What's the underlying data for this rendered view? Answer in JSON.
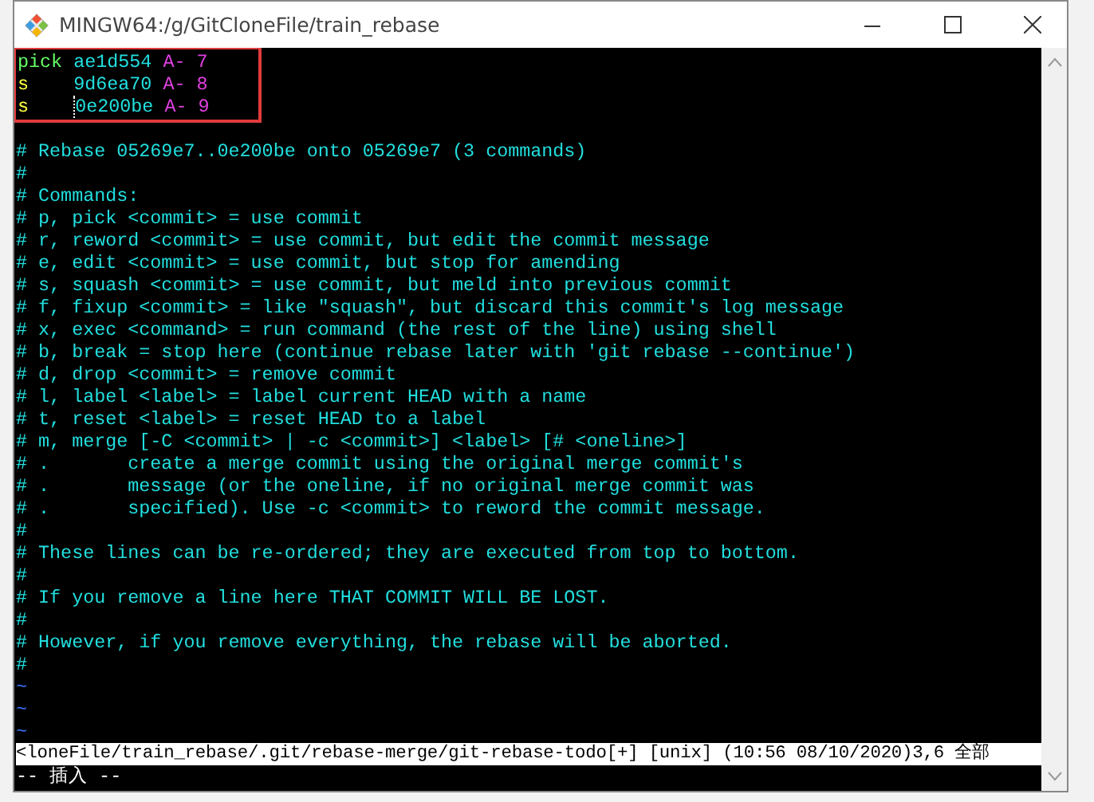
{
  "window": {
    "title": "MINGW64:/g/GitCloneFile/train_rebase"
  },
  "todo": [
    {
      "kind": "pick",
      "command": "pick",
      "hash": "ae1d554",
      "subject": "A- 7"
    },
    {
      "kind": "squash",
      "command": "s   ",
      "hash": "9d6ea70",
      "subject": "A- 8"
    },
    {
      "kind": "squash",
      "command": "s   ",
      "hash": "0e200be",
      "subject": "A- 9"
    }
  ],
  "comments": [
    "# Rebase 05269e7..0e200be onto 05269e7 (3 commands)",
    "#",
    "# Commands:",
    "# p, pick <commit> = use commit",
    "# r, reword <commit> = use commit, but edit the commit message",
    "# e, edit <commit> = use commit, but stop for amending",
    "# s, squash <commit> = use commit, but meld into previous commit",
    "# f, fixup <commit> = like \"squash\", but discard this commit's log message",
    "# x, exec <command> = run command (the rest of the line) using shell",
    "# b, break = stop here (continue rebase later with 'git rebase --continue')",
    "# d, drop <commit> = remove commit",
    "# l, label <label> = label current HEAD with a name",
    "# t, reset <label> = reset HEAD to a label",
    "# m, merge [-C <commit> | -c <commit>] <label> [# <oneline>]",
    "# .       create a merge commit using the original merge commit's",
    "# .       message (or the oneline, if no original merge commit was",
    "# .       specified). Use -c <commit> to reword the commit message.",
    "#",
    "# These lines can be re-ordered; they are executed from top to bottom.",
    "#",
    "# If you remove a line here THAT COMMIT WILL BE LOST.",
    "#",
    "# However, if you remove everything, the rebase will be aborted.",
    "#"
  ],
  "empty_lines": [
    "~",
    "~",
    "~"
  ],
  "status_line": "<loneFile/train_rebase/.git/rebase-merge/git-rebase-todo[+] [unix] (10:56 08/10/2020)3,6 全部",
  "mode_line": "-- 插入 --"
}
